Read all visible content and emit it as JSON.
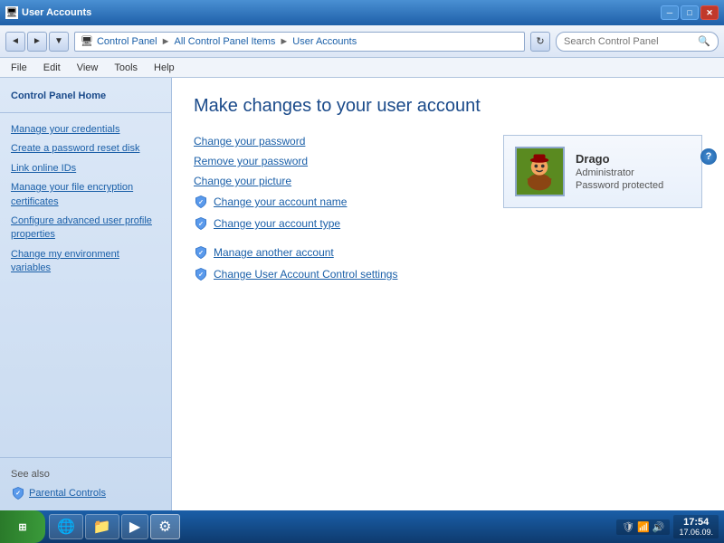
{
  "titlebar": {
    "title": "User Accounts",
    "minimize": "─",
    "maximize": "□",
    "close": "✕"
  },
  "addressbar": {
    "back": "◄",
    "forward": "►",
    "refresh": "↻",
    "path": {
      "root": "Control Panel",
      "level1": "All Control Panel Items",
      "level2": "User Accounts"
    },
    "search_placeholder": "Search Control Panel"
  },
  "menubar": {
    "items": [
      "File",
      "Edit",
      "View",
      "Tools",
      "Help"
    ]
  },
  "sidebar": {
    "title": "Control Panel Home",
    "links": [
      {
        "id": "manage-credentials",
        "label": "Manage your credentials"
      },
      {
        "id": "create-password-reset",
        "label": "Create a password reset disk"
      },
      {
        "id": "link-online-ids",
        "label": "Link online IDs"
      },
      {
        "id": "manage-file-encryption",
        "label": "Manage your file encryption certificates"
      },
      {
        "id": "configure-advanced-profile",
        "label": "Configure advanced user profile properties"
      },
      {
        "id": "change-environment",
        "label": "Change my environment variables"
      }
    ],
    "see_also": "See also",
    "see_also_links": [
      {
        "id": "parental-controls",
        "label": "Parental Controls"
      }
    ]
  },
  "content": {
    "title": "Make changes to your user account",
    "actions": [
      {
        "id": "change-password",
        "label": "Change your password",
        "has_shield": false
      },
      {
        "id": "remove-password",
        "label": "Remove your password",
        "has_shield": false
      },
      {
        "id": "change-picture",
        "label": "Change your picture",
        "has_shield": false
      },
      {
        "id": "change-account-name",
        "label": "Change your account name",
        "has_shield": true
      },
      {
        "id": "change-account-type",
        "label": "Change your account type",
        "has_shield": true
      }
    ],
    "secondary_actions": [
      {
        "id": "manage-another-account",
        "label": "Manage another account",
        "has_shield": true
      },
      {
        "id": "change-uac-settings",
        "label": "Change User Account Control settings",
        "has_shield": true
      }
    ]
  },
  "user_card": {
    "name": "Drago",
    "role": "Administrator",
    "status": "Password protected"
  },
  "taskbar": {
    "start_label": "⊞",
    "items": [
      {
        "id": "ie",
        "icon": "🌐",
        "active": false
      },
      {
        "id": "folder",
        "icon": "📁",
        "active": false
      },
      {
        "id": "media",
        "icon": "▶",
        "active": false
      },
      {
        "id": "control-panel",
        "icon": "⚙",
        "active": true
      }
    ],
    "tray_icons": [
      "🛡",
      "📶",
      "🔊"
    ],
    "clock_time": "17:54",
    "clock_date": "17.06.09."
  }
}
